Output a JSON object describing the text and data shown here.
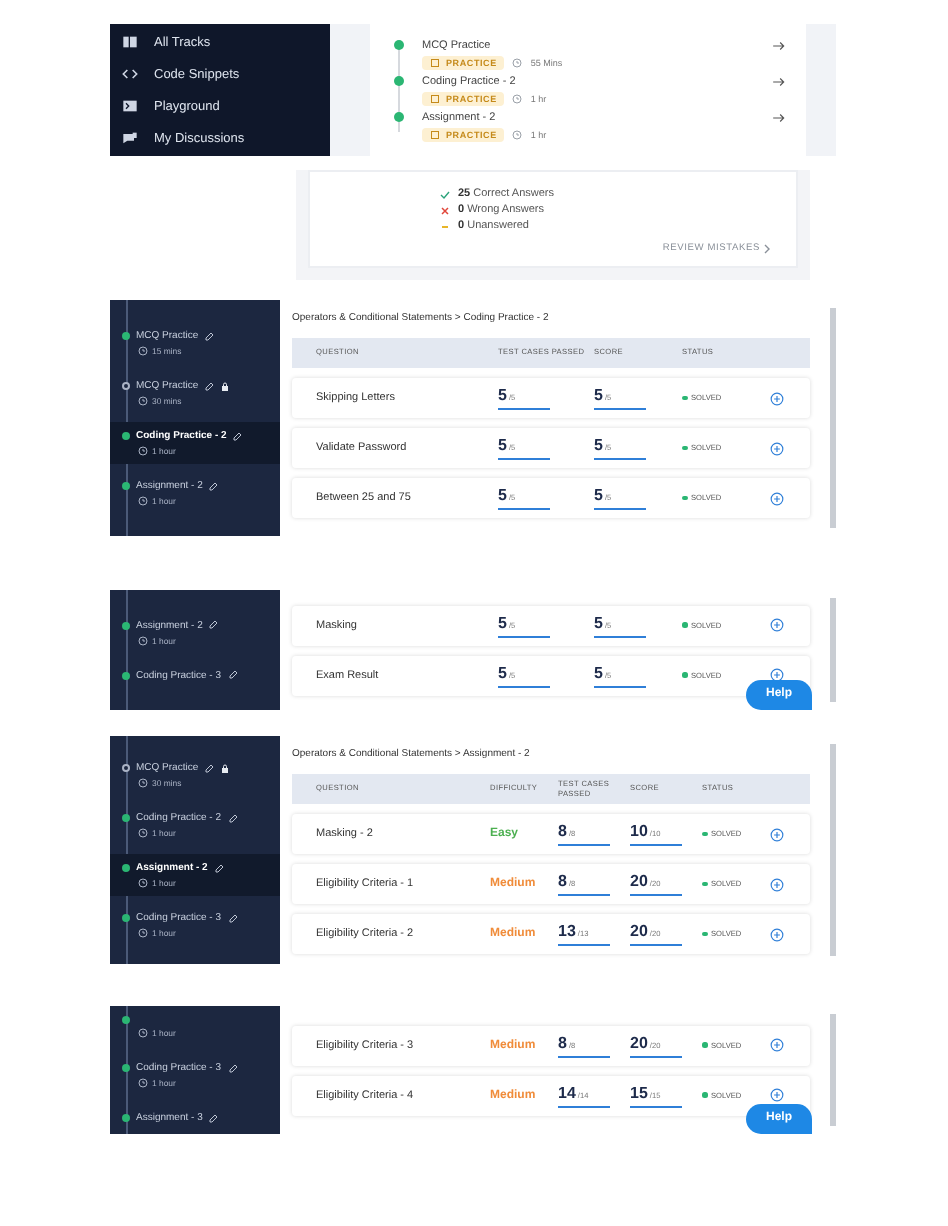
{
  "panels": [
    {
      "kind": "track",
      "nav": [
        {
          "label": "All Tracks"
        },
        {
          "label": "Code Snippets"
        },
        {
          "label": "Playground"
        },
        {
          "label": "My Discussions"
        }
      ],
      "items": [
        {
          "title": "MCQ Practice",
          "tag": "PRACTICE",
          "duration": "55 Mins"
        },
        {
          "title": "Coding Practice - 2",
          "tag": "PRACTICE",
          "duration": "1 hr"
        },
        {
          "title": "Assignment - 2",
          "tag": "PRACTICE",
          "duration": "1 hr"
        }
      ]
    },
    {
      "kind": "summary",
      "stats": [
        {
          "kind": "correct",
          "count": "25",
          "label": "Correct Answers"
        },
        {
          "kind": "wrong",
          "count": "0",
          "label": "Wrong Answers"
        },
        {
          "kind": "unanswered",
          "count": "0",
          "label": "Unanswered"
        }
      ],
      "link": "REVIEW MISTAKES"
    },
    {
      "kind": "table",
      "sidebar": [
        {
          "title": "MCQ Practice",
          "time": "15 mins",
          "done": true,
          "locked": false,
          "selected": false
        },
        {
          "title": "MCQ Practice",
          "time": "30 mins",
          "done": false,
          "locked": true,
          "selected": false
        },
        {
          "title": "Coding Practice - 2",
          "time": "1 hour",
          "done": true,
          "locked": false,
          "selected": true
        },
        {
          "title": "Assignment - 2",
          "time": "1 hour",
          "done": true,
          "locked": false,
          "selected": false
        }
      ],
      "breadcrumb": "Operators & Conditional Statements > Coding Practice - 2",
      "columns": [
        "QUESTION",
        "TEST CASES PASSED",
        "SCORE",
        "STATUS"
      ],
      "rows": [
        {
          "question": "Skipping Letters",
          "passed": "5",
          "passed_total": "/5",
          "score": "5",
          "score_total": "/5",
          "status": "SOLVED"
        },
        {
          "question": "Validate Password",
          "passed": "5",
          "passed_total": "/5",
          "score": "5",
          "score_total": "/5",
          "status": "SOLVED"
        },
        {
          "question": "Between 25 and 75",
          "passed": "5",
          "passed_total": "/5",
          "score": "5",
          "score_total": "/5",
          "status": "SOLVED"
        }
      ]
    },
    {
      "kind": "table",
      "sidebar": [
        {
          "title": "Assignment - 2",
          "time": "1 hour",
          "done": true,
          "locked": false,
          "selected": false
        },
        {
          "title": "Coding Practice - 3",
          "done": true,
          "locked": false,
          "selected": false
        }
      ],
      "rows": [
        {
          "question": "Masking",
          "passed": "5",
          "passed_total": "/5",
          "score": "5",
          "score_total": "/5",
          "status": "SOLVED"
        },
        {
          "question": "Exam Result",
          "passed": "5",
          "passed_total": "/5",
          "score": "5",
          "score_total": "/5",
          "status": "SOLVED"
        }
      ],
      "help": "Help"
    },
    {
      "kind": "table",
      "sidebar": [
        {
          "title": "MCQ Practice",
          "time": "30 mins",
          "done": false,
          "locked": true,
          "selected": false
        },
        {
          "title": "Coding Practice - 2",
          "time": "1 hour",
          "done": true,
          "locked": false,
          "selected": false
        },
        {
          "title": "Assignment - 2",
          "time": "1 hour",
          "done": true,
          "locked": false,
          "selected": true
        },
        {
          "title": "Coding Practice - 3",
          "time": "1 hour",
          "done": true,
          "locked": false,
          "selected": false
        }
      ],
      "breadcrumb": "Operators & Conditional Statements > Assignment - 2",
      "columns": [
        "QUESTION",
        "DIFFICULTY",
        "TEST CASES PASSED",
        "SCORE",
        "STATUS"
      ],
      "rows": [
        {
          "question": "Masking - 2",
          "difficulty": {
            "label": "Easy",
            "color": "#4caf50"
          },
          "passed": "8",
          "passed_total": "/8",
          "score": "10",
          "score_total": "/10",
          "status": "SOLVED"
        },
        {
          "question": "Eligibility Criteria - 1",
          "difficulty": {
            "label": "Medium",
            "color": "#f08c3a"
          },
          "passed": "8",
          "passed_total": "/8",
          "score": "20",
          "score_total": "/20",
          "status": "SOLVED"
        },
        {
          "question": "Eligibility Criteria - 2",
          "difficulty": {
            "label": "Medium",
            "color": "#f08c3a"
          },
          "passed": "13",
          "passed_total": "/13",
          "score": "20",
          "score_total": "/20",
          "status": "SOLVED"
        }
      ]
    },
    {
      "kind": "table",
      "sidebar": [
        {
          "time": "1 hour",
          "done": true,
          "locked": false,
          "selected": false
        },
        {
          "title": "Coding Practice - 3",
          "time": "1 hour",
          "done": true,
          "locked": false,
          "selected": false
        },
        {
          "title": "Assignment - 3",
          "done": true,
          "locked": false,
          "selected": false
        }
      ],
      "rows": [
        {
          "question": "Eligibility Criteria - 3",
          "difficulty": {
            "label": "Medium",
            "color": "#f08c3a"
          },
          "passed": "8",
          "passed_total": "/8",
          "score": "20",
          "score_total": "/20",
          "status": "SOLVED"
        },
        {
          "question": "Eligibility Criteria - 4",
          "difficulty": {
            "label": "Medium",
            "color": "#f08c3a"
          },
          "passed": "14",
          "passed_total": "/14",
          "score": "15",
          "score_total": "/15",
          "status": "SOLVED"
        }
      ],
      "help": "Help"
    }
  ]
}
